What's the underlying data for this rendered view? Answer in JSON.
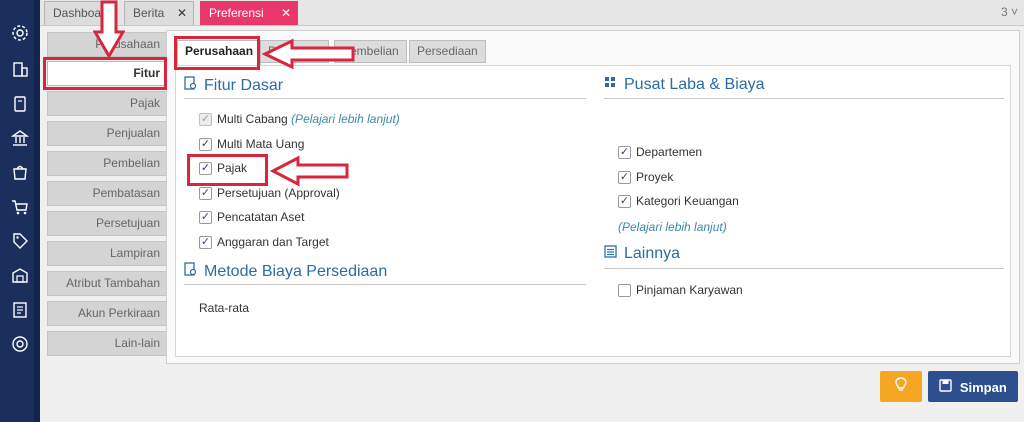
{
  "rail_icons": [
    "gear-icon",
    "building-icon",
    "book-icon",
    "bank-icon",
    "shopping-bag-icon",
    "cart-icon",
    "tag-icon",
    "warehouse-icon",
    "report-icon",
    "target-icon"
  ],
  "top_tabs": [
    {
      "label": "Dashboard"
    },
    {
      "label": "Berita",
      "close": "✕"
    },
    {
      "label": "Preferensi",
      "close": "✕"
    }
  ],
  "top_count": "3 ˅",
  "side_menu": [
    "Perusahaan",
    "Fitur",
    "Pajak",
    "Penjualan",
    "Pembelian",
    "Pembatasan",
    "Persetujuan",
    "Lampiran",
    "Atribut Tambahan",
    "Akun Perkiraan",
    "Lain-lain"
  ],
  "sub_tabs": [
    "Perusahaan",
    "Penjualan",
    "Pembelian",
    "Persediaan"
  ],
  "fitur_dasar": {
    "title": "Fitur Dasar",
    "items": [
      {
        "label": "Multi Cabang",
        "link": "(Pelajari lebih lanjut)",
        "checked": true,
        "disabled": true
      },
      {
        "label": "Multi Mata Uang",
        "checked": true
      },
      {
        "label": "Pajak",
        "checked": true
      },
      {
        "label": "Persetujuan (Approval)",
        "checked": true
      },
      {
        "label": "Pencatatan Aset",
        "checked": true
      },
      {
        "label": "Anggaran dan Target",
        "checked": true
      }
    ]
  },
  "metode": {
    "title": "Metode Biaya Persediaan",
    "value": "Rata-rata"
  },
  "pusat": {
    "title": "Pusat Laba & Biaya",
    "items": [
      {
        "label": "Departemen",
        "checked": true
      },
      {
        "label": "Proyek",
        "checked": true
      },
      {
        "label": "Kategori Keuangan",
        "checked": true
      }
    ],
    "link": "(Pelajari lebih lanjut)"
  },
  "lainnya": {
    "title": "Lainnya",
    "items": [
      {
        "label": "Pinjaman Karyawan",
        "checked": false
      }
    ]
  },
  "buttons": {
    "tip_icon": "lightbulb-icon",
    "save_label": "Simpan",
    "save_icon": "floppy-icon"
  },
  "colors": {
    "rail": "#1a2f5c",
    "active_tab": "#e8386b",
    "section_title": "#2c6ca3",
    "save_button": "#2d4f8e",
    "tip_button": "#f5a623",
    "annotation": "#d7263d"
  }
}
